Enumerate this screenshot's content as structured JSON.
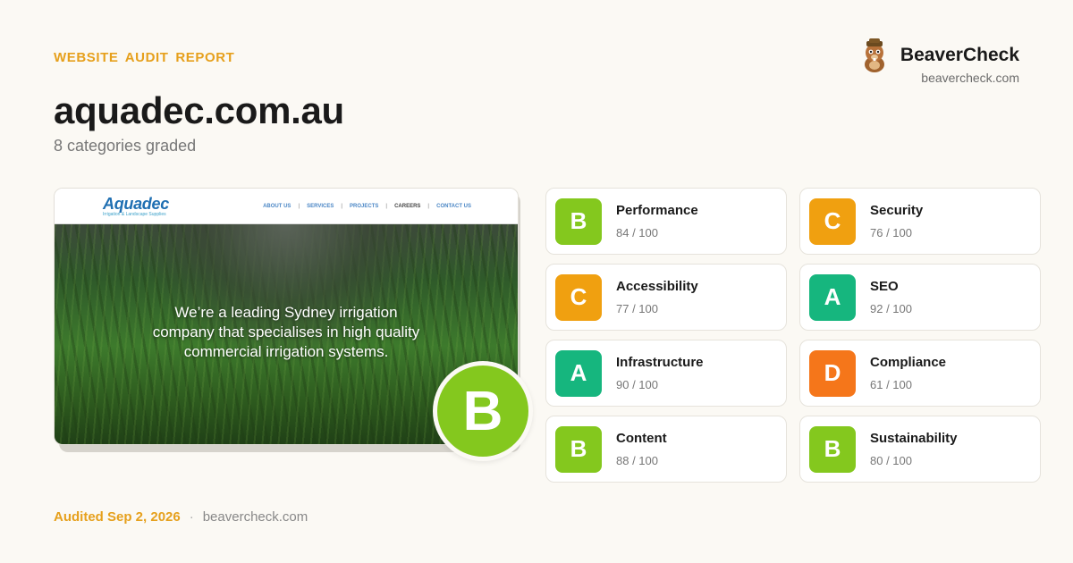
{
  "eyebrow": "WEBSITE  AUDIT  REPORT",
  "brand": {
    "name": "BeaverCheck",
    "url": "beavercheck.com",
    "icon": "beaver-icon"
  },
  "site": {
    "domain": "aquadec.com.au",
    "subtitle": "8 categories graded"
  },
  "screenshot": {
    "logo": "Aquadec",
    "logo_tagline": "Irrigation & Landscape Supplies",
    "nav": [
      "ABOUT US",
      "SERVICES",
      "PROJECTS",
      "CAREERS",
      "CONTACT US"
    ],
    "hero_lines": [
      "We’re a leading Sydney irrigation",
      "company that specialises in high quality",
      "commercial irrigation systems."
    ]
  },
  "overall_grade": "B",
  "overall_color": "#84c81e",
  "categories": [
    {
      "name": "Performance",
      "grade": "B",
      "score": "84 / 100",
      "color": "#84c81e"
    },
    {
      "name": "Security",
      "grade": "C",
      "score": "76 / 100",
      "color": "#f0a010"
    },
    {
      "name": "Accessibility",
      "grade": "C",
      "score": "77 / 100",
      "color": "#f0a010"
    },
    {
      "name": "SEO",
      "grade": "A",
      "score": "92 / 100",
      "color": "#16b67e"
    },
    {
      "name": "Infrastructure",
      "grade": "A",
      "score": "90 / 100",
      "color": "#16b67e"
    },
    {
      "name": "Compliance",
      "grade": "D",
      "score": "61 / 100",
      "color": "#f5761a"
    },
    {
      "name": "Content",
      "grade": "B",
      "score": "88 / 100",
      "color": "#84c81e"
    },
    {
      "name": "Sustainability",
      "grade": "B",
      "score": "80 / 100",
      "color": "#84c81e"
    }
  ],
  "footer": {
    "audited": "Audited Sep 2, 2026",
    "separator": "·",
    "url": "beavercheck.com"
  }
}
